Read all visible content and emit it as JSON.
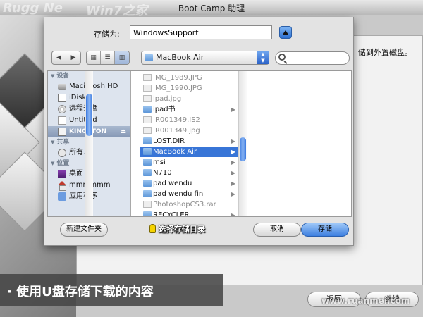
{
  "watermarks": [
    "Rugg Ne",
    "Win7之家"
  ],
  "window": {
    "title": "Boot Camp 助理"
  },
  "background": {
    "instruction_fragment": "储到外置磁盘。",
    "buttons": [
      "返回",
      "继续"
    ]
  },
  "save_sheet": {
    "save_as_label": "存储为:",
    "save_as_value": "WindowsSupport",
    "location": "MacBook Air",
    "search_placeholder": "",
    "sidebar": {
      "sections": [
        {
          "heading": "设备",
          "items": [
            {
              "label": "Macintosh HD",
              "icon": "hard-drive-icon"
            },
            {
              "label": "iDisk",
              "icon": "idisk-icon"
            },
            {
              "label": "远程光盘",
              "icon": "remote-disc-icon"
            },
            {
              "label": "Untitled",
              "icon": "disk-icon"
            },
            {
              "label": "KINGSTON",
              "icon": "usb-drive-icon",
              "selected": true
            }
          ]
        },
        {
          "heading": "共享",
          "items": [
            {
              "label": "所有...",
              "icon": "network-icon"
            }
          ]
        },
        {
          "heading": "位置",
          "items": [
            {
              "label": "桌面",
              "icon": "desktop-icon"
            },
            {
              "label": "mmmmmm",
              "icon": "home-icon"
            },
            {
              "label": "应用程序",
              "icon": "applications-icon"
            }
          ]
        }
      ]
    },
    "files": [
      {
        "name": "IMG_1989.JPG",
        "kind": "doc",
        "dim": true
      },
      {
        "name": "IMG_1990.JPG",
        "kind": "doc",
        "dim": true
      },
      {
        "name": "ipad.jpg",
        "kind": "doc",
        "dim": true
      },
      {
        "name": "ipad书",
        "kind": "folder",
        "arrow": true
      },
      {
        "name": "IR001349.IS2",
        "kind": "doc",
        "dim": true
      },
      {
        "name": "IR001349.jpg",
        "kind": "doc",
        "dim": true
      },
      {
        "name": "LOST.DIR",
        "kind": "folder",
        "arrow": true
      },
      {
        "name": "MacBook Air",
        "kind": "folder",
        "arrow": true,
        "selected": true
      },
      {
        "name": "msi",
        "kind": "folder",
        "arrow": true
      },
      {
        "name": "N710",
        "kind": "folder",
        "arrow": true
      },
      {
        "name": "pad wendu",
        "kind": "folder",
        "arrow": true
      },
      {
        "name": "pad wendu fin",
        "kind": "folder",
        "arrow": true
      },
      {
        "name": "PhotoshopCS3.rar",
        "kind": "doc",
        "dim": true
      },
      {
        "name": "RECYCLER",
        "kind": "folder",
        "arrow": true
      }
    ],
    "buttons": {
      "new_folder": "新建文件夹",
      "cancel": "取消",
      "save": "存储"
    },
    "annotation": "选择存储目录"
  },
  "caption": "· 使用U盘存储下载的内容",
  "bottom_watermark": "www.ruanmei.com",
  "colors": {
    "selection": "#3875d7",
    "accent": "#3d7fe0"
  }
}
